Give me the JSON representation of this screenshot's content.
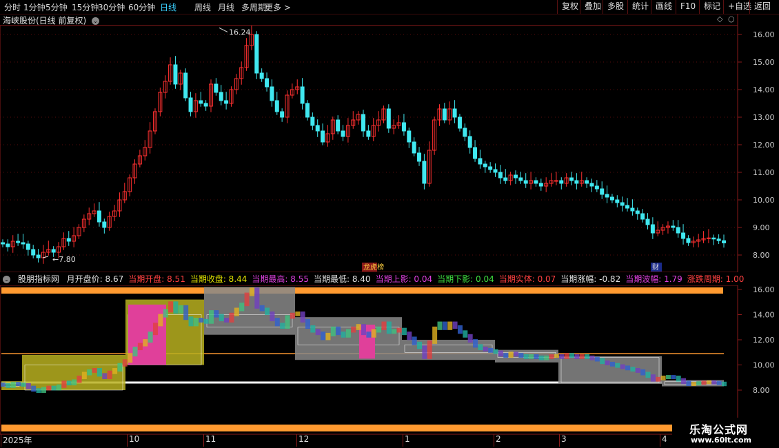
{
  "toolbar": {
    "periods": [
      "分时",
      "1分钟",
      "5分钟",
      "15分钟",
      "30分钟",
      "60分钟",
      "日线",
      "周线",
      "月线",
      "多周期",
      "更多 >"
    ],
    "active": "日线",
    "right_buttons": [
      "复权",
      "叠加",
      "多股",
      "统计",
      "画线",
      "F10",
      "标记",
      "+自选",
      "返回"
    ]
  },
  "stock": {
    "title": "海峡股份(日线 前复权)"
  },
  "main_chart": {
    "y_ticks": [
      "16.00",
      "15.00",
      "14.00",
      "13.00",
      "12.00",
      "11.00",
      "10.00",
      "9.00",
      "8.00"
    ],
    "high_label": "16.24",
    "low_label": "7.80",
    "markers": [
      "龙虎榜",
      "财"
    ]
  },
  "indicator": {
    "name": "股朋指标网",
    "items": [
      {
        "label": "月开盘价: 8.67",
        "color": "#e0e0e0"
      },
      {
        "label": "当期开盘: 8.51",
        "color": "#ff4040"
      },
      {
        "label": "当期收盘: 8.44",
        "color": "#e0e000"
      },
      {
        "label": "当期最高: 8.55",
        "color": "#e040e0"
      },
      {
        "label": "当期最低: 8.40",
        "color": "#e0e0e0"
      },
      {
        "label": "当期上影: 0.04",
        "color": "#e040e0"
      },
      {
        "label": "当期下影: 0.04",
        "color": "#40e040"
      },
      {
        "label": "当期实体: 0.07",
        "color": "#ff4040"
      },
      {
        "label": "当期涨幅: -0.82",
        "color": "#e0e0e0"
      },
      {
        "label": "当期波幅: 1.79",
        "color": "#e040e0"
      },
      {
        "label": "涨跌周期: 1.00",
        "color": "#ff4040"
      }
    ],
    "y_ticks": [
      "16.00",
      "14.00",
      "12.00",
      "10.00",
      "8.00"
    ]
  },
  "x_axis": [
    "2025年",
    "10",
    "11",
    "12",
    "1",
    "2",
    "3",
    "4"
  ],
  "watermark": {
    "name": "乐淘公式网",
    "url": "www.60lt.com"
  },
  "colors": {
    "up": "#ff3030",
    "down": "#40e8f0",
    "grid": "#8a1a1a",
    "orange": "#ff9a30"
  }
}
